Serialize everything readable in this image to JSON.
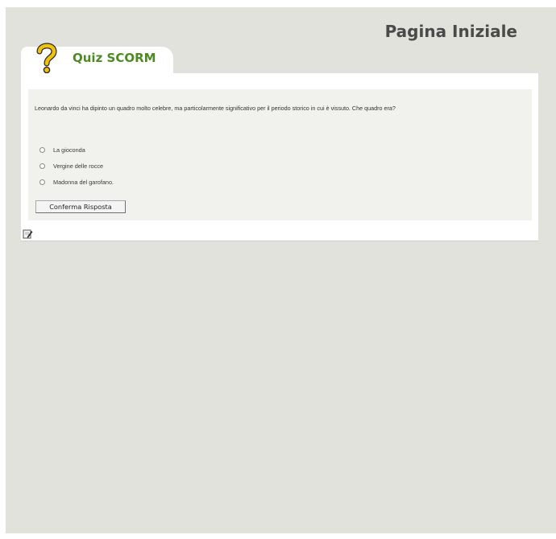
{
  "header": {
    "title": "Pagina Iniziale"
  },
  "tab": {
    "label": "Quiz SCORM",
    "icon": "question-mark-icon"
  },
  "quiz": {
    "question": "Leonardo da vinci ha dipinto un quadro molto celebre, ma particolarmente significativo per il periodo storico in cui è vissuto. Che quadro era?",
    "options": [
      "La gioconda",
      "Vergine delle rocce",
      "Madonna del garofano."
    ],
    "submit_label": "Conferma Risposta"
  },
  "footer": {
    "icon": "edit-icon"
  },
  "colors": {
    "background": "#e2e2dc",
    "tab_label": "#4d8a22",
    "title": "#4a4a4a"
  }
}
